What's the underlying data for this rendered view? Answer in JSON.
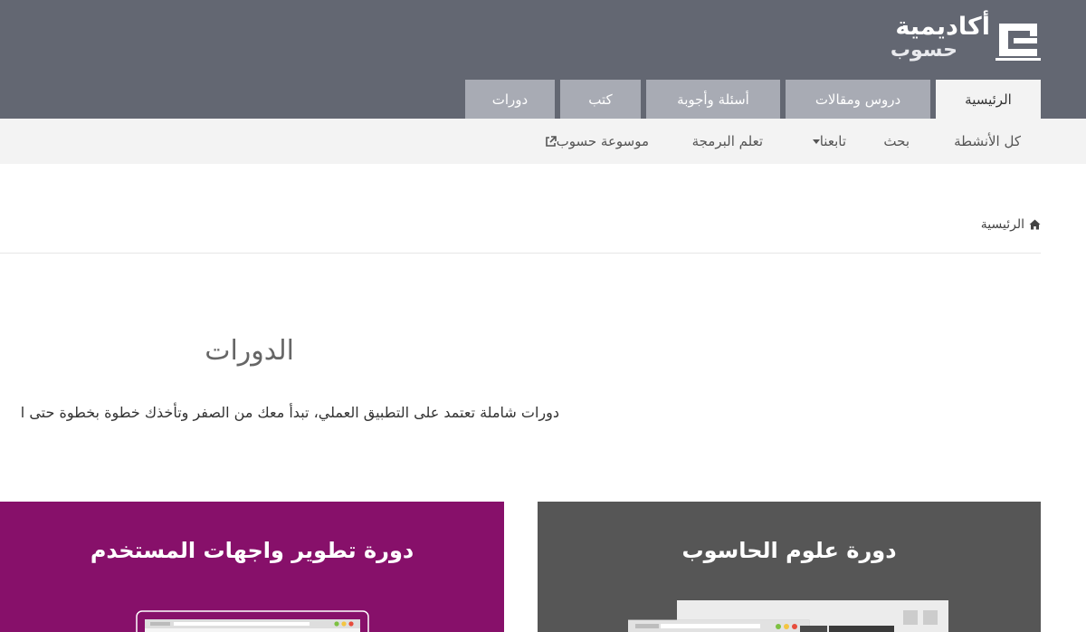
{
  "brand": {
    "title": "أكاديمية",
    "subtitle": "حسوب"
  },
  "tabs": [
    {
      "label": "الرئيسية",
      "active": true
    },
    {
      "label": "دروس ومقالات",
      "active": false
    },
    {
      "label": "أسئلة وأجوبة",
      "active": false
    },
    {
      "label": "كتب",
      "active": false
    },
    {
      "label": "دورات",
      "active": false
    }
  ],
  "subnav": {
    "items": [
      {
        "label": "كل الأنشطة"
      },
      {
        "label": "بحث"
      },
      {
        "label": "تابعنا"
      },
      {
        "label": "تعلم البرمجة"
      },
      {
        "label": "موسوعة حسوب"
      }
    ]
  },
  "breadcrumb": {
    "home_label": "الرئيسية"
  },
  "main": {
    "title": "الدورات",
    "description": "دورات شاملة تعتمد على التطبيق العملي، تبدأ معك من الصفر وتأخذك خطوة بخطوة حتى ا"
  },
  "courses": [
    {
      "title": "دورة علوم الحاسوب",
      "color": "#565656"
    },
    {
      "title": "دورة تطوير واجهات المستخدم",
      "color": "#87106a"
    }
  ],
  "colors": {
    "header_bg": "#636772",
    "tab_bg": "#a8abb4",
    "tab_active_bg": "#f3f3f3",
    "subnav_bg": "#f3f3f3"
  }
}
